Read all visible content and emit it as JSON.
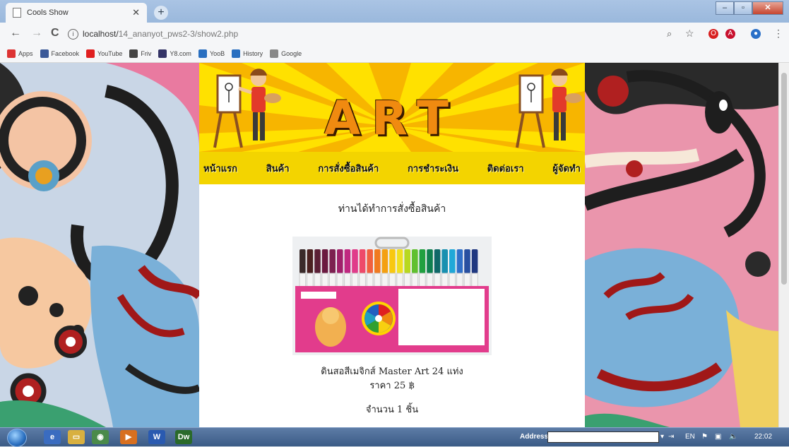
{
  "browser": {
    "tab_title": "Cools Show",
    "new_tab": "+",
    "url_host": "localhost/",
    "url_path": "14_ananyot_pws2-3/show2.php",
    "nav": {
      "back": "←",
      "forward": "→",
      "reload": "C"
    }
  },
  "bookmarks": [
    {
      "label": "Apps",
      "color": "#d33"
    },
    {
      "label": "Facebook",
      "color": "#3b5998"
    },
    {
      "label": "YouTube",
      "color": "#e02020"
    },
    {
      "label": "Friv",
      "color": "#444"
    },
    {
      "label": "Y8.com",
      "color": "#336"
    },
    {
      "label": "YooB",
      "color": "#2a6fc0"
    },
    {
      "label": "History",
      "color": "#2a6fc0"
    },
    {
      "label": "Google",
      "color": "#888"
    }
  ],
  "site": {
    "banner_title": "ART",
    "menu": [
      "หน้าแรก",
      "สินค้า",
      "การสั่งซื้อสินค้า",
      "การชำระเงิน",
      "ติดต่อเรา",
      "ผู้จัดทำ"
    ],
    "order_message": "ท่านได้ทำการสั่งซื้อสินค้า",
    "product_name": "ดินสอสีเมจิกส์ Master Art 24 แท่ง",
    "product_price": "ราคา 25 ฿",
    "product_quantity": "จำนวน 1 ชิ้น"
  },
  "taskbar": {
    "address_label": "Address",
    "lang": "EN",
    "clock": "22:02"
  },
  "marker_colors": [
    "#3a2a2a",
    "#4a2020",
    "#5b1f35",
    "#6b1a40",
    "#7d2050",
    "#a0206a",
    "#c02880",
    "#e03c8a",
    "#ee4a6a",
    "#f06040",
    "#f07a20",
    "#f4a010",
    "#f8c810",
    "#f0e020",
    "#b8d820",
    "#60c030",
    "#20a040",
    "#108050",
    "#106868",
    "#1890b0",
    "#20a8d8",
    "#3070c8",
    "#2850a0",
    "#203880"
  ]
}
